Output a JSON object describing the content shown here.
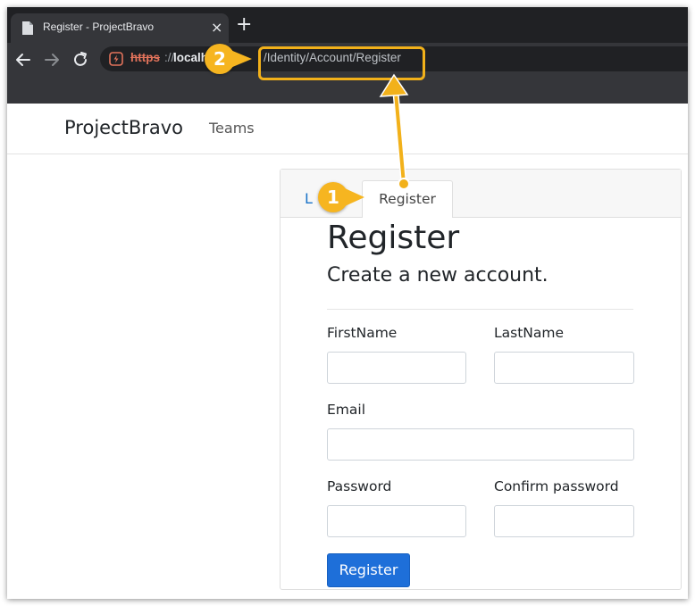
{
  "browser": {
    "tab_title": "Register - ProjectBravo",
    "tab_close": "×",
    "new_tab": "+",
    "address": {
      "scheme": "https",
      "separator": "://",
      "host": "localh",
      "path": "/Identity/Account/Register"
    }
  },
  "navbar": {
    "brand": "ProjectBravo",
    "links": [
      "Teams"
    ]
  },
  "card": {
    "tabs": {
      "login": "L",
      "register": "Register"
    },
    "heading": "Register",
    "subheading": "Create a new account.",
    "fields": {
      "first_name": {
        "label": "FirstName",
        "value": ""
      },
      "last_name": {
        "label": "LastName",
        "value": ""
      },
      "email": {
        "label": "Email",
        "value": ""
      },
      "password": {
        "label": "Password",
        "value": ""
      },
      "confirm_password": {
        "label": "Confirm password",
        "value": ""
      }
    },
    "submit_label": "Register"
  },
  "annotations": {
    "badge_1": "1",
    "badge_2": "2",
    "accent_color": "#f2b11a"
  }
}
